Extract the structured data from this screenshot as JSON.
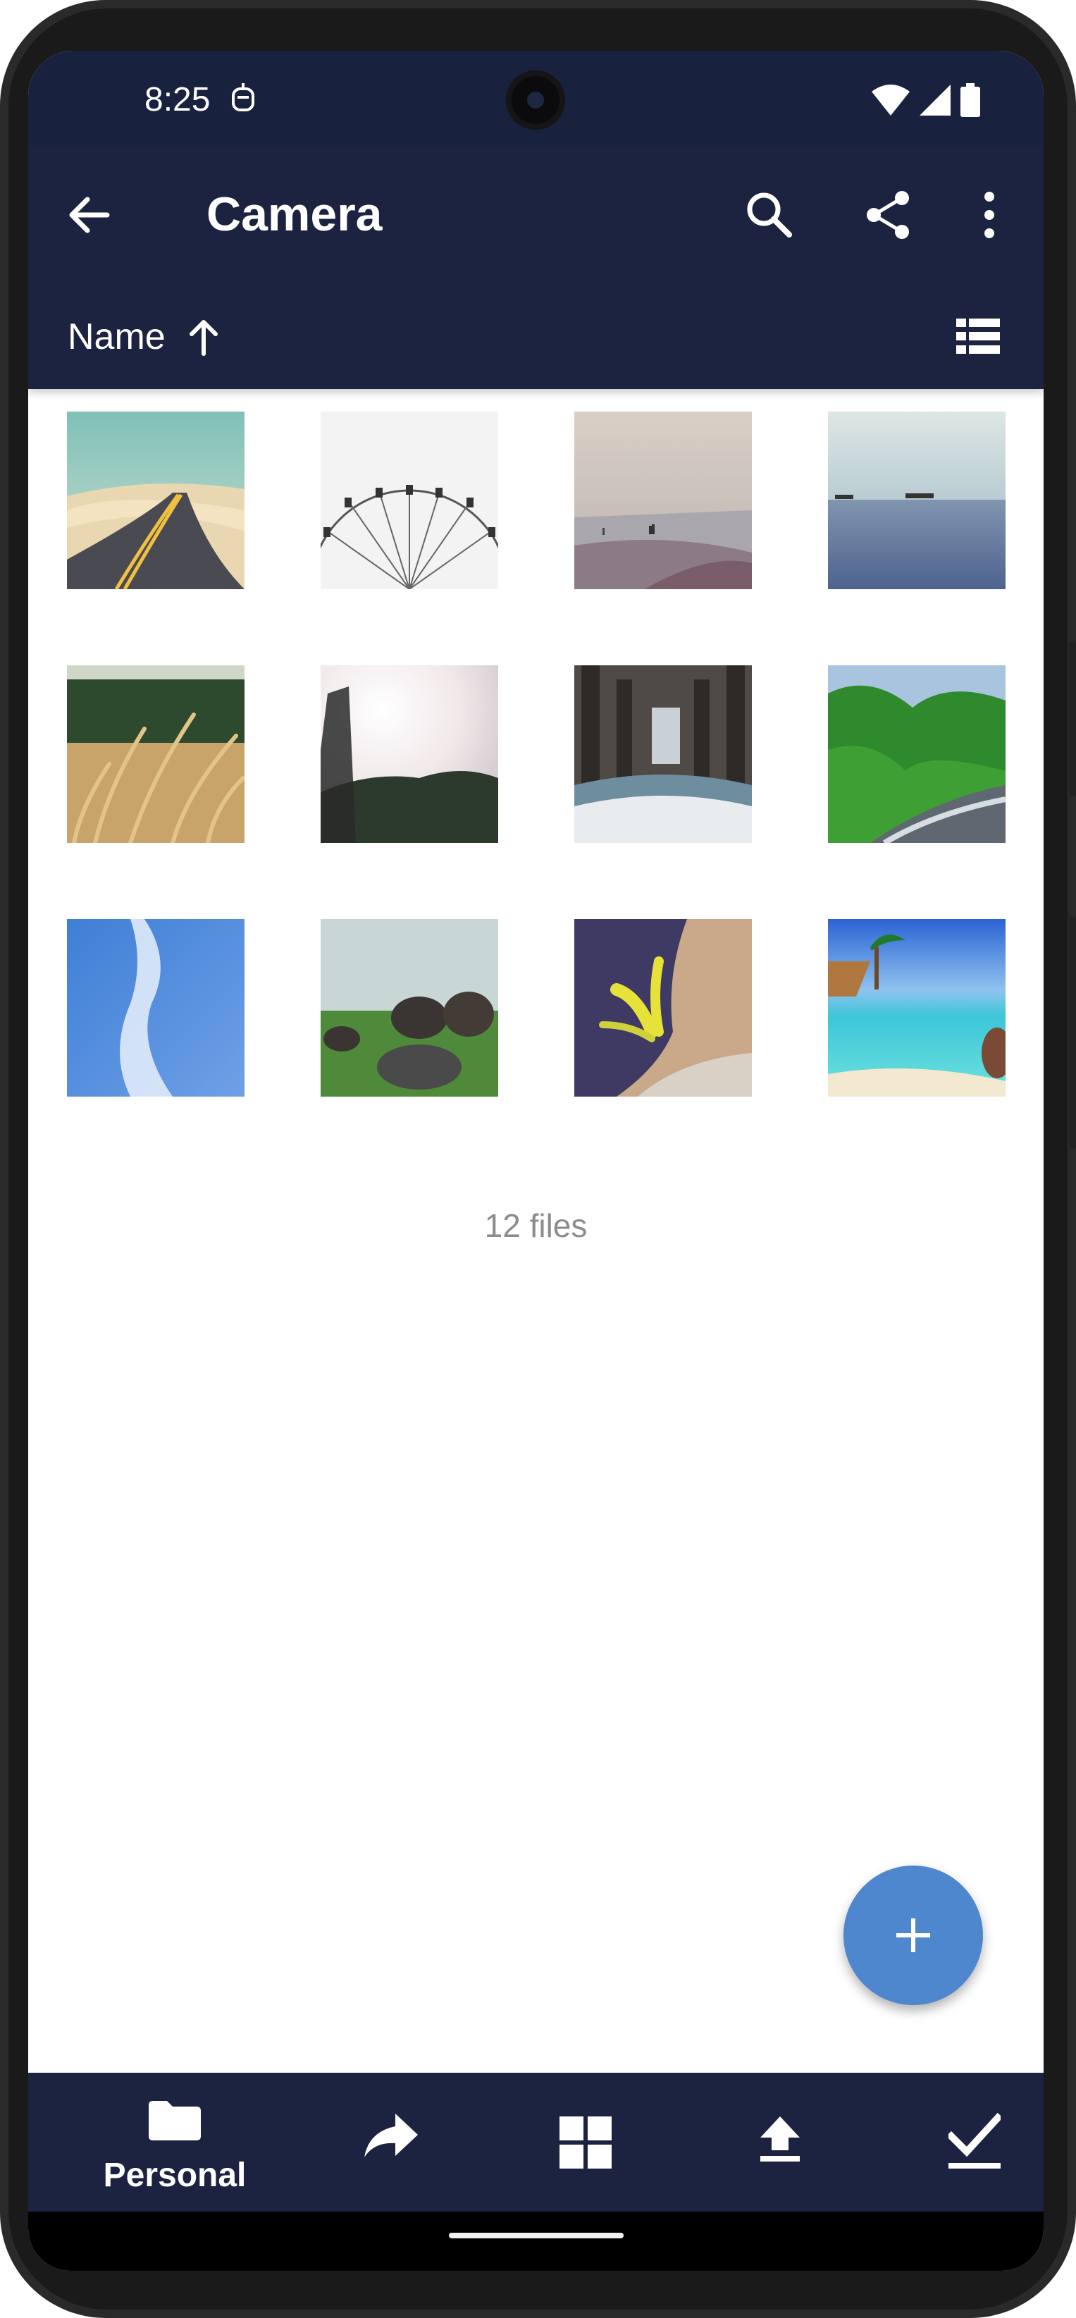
{
  "status_bar": {
    "time": "8:25",
    "icons": [
      "bot-icon",
      "wifi-icon",
      "signal-icon",
      "battery-icon"
    ]
  },
  "app_bar": {
    "title": "Camera",
    "actions": [
      "search-icon",
      "share-icon",
      "more-vert-icon"
    ]
  },
  "sort_bar": {
    "label": "Name",
    "direction": "ascending",
    "view_toggle": "list-view-icon"
  },
  "gallery": {
    "items": [
      {
        "subject": "desert road"
      },
      {
        "subject": "ferris wheel"
      },
      {
        "subject": "misty beach"
      },
      {
        "subject": "sea horizon with ships"
      },
      {
        "subject": "wheat field"
      },
      {
        "subject": "sunlit forest figure"
      },
      {
        "subject": "under pier"
      },
      {
        "subject": "green valley stream"
      },
      {
        "subject": "blue sky clouds"
      },
      {
        "subject": "rocks on grass"
      },
      {
        "subject": "yellow plant on rock"
      },
      {
        "subject": "tropical beach"
      }
    ],
    "count_label": "12 files"
  },
  "fab": {
    "icon": "plus-icon"
  },
  "bottom_nav": {
    "items": [
      {
        "icon": "folder-icon",
        "label": "Personal",
        "active": true
      },
      {
        "icon": "share-forward-icon",
        "label": ""
      },
      {
        "icon": "grid-icon",
        "label": ""
      },
      {
        "icon": "upload-icon",
        "label": ""
      },
      {
        "icon": "check-icon",
        "label": ""
      }
    ]
  },
  "colors": {
    "app_bar": "#1b2340",
    "fab": "#4f87cf",
    "count_text": "#8c8c8c"
  }
}
